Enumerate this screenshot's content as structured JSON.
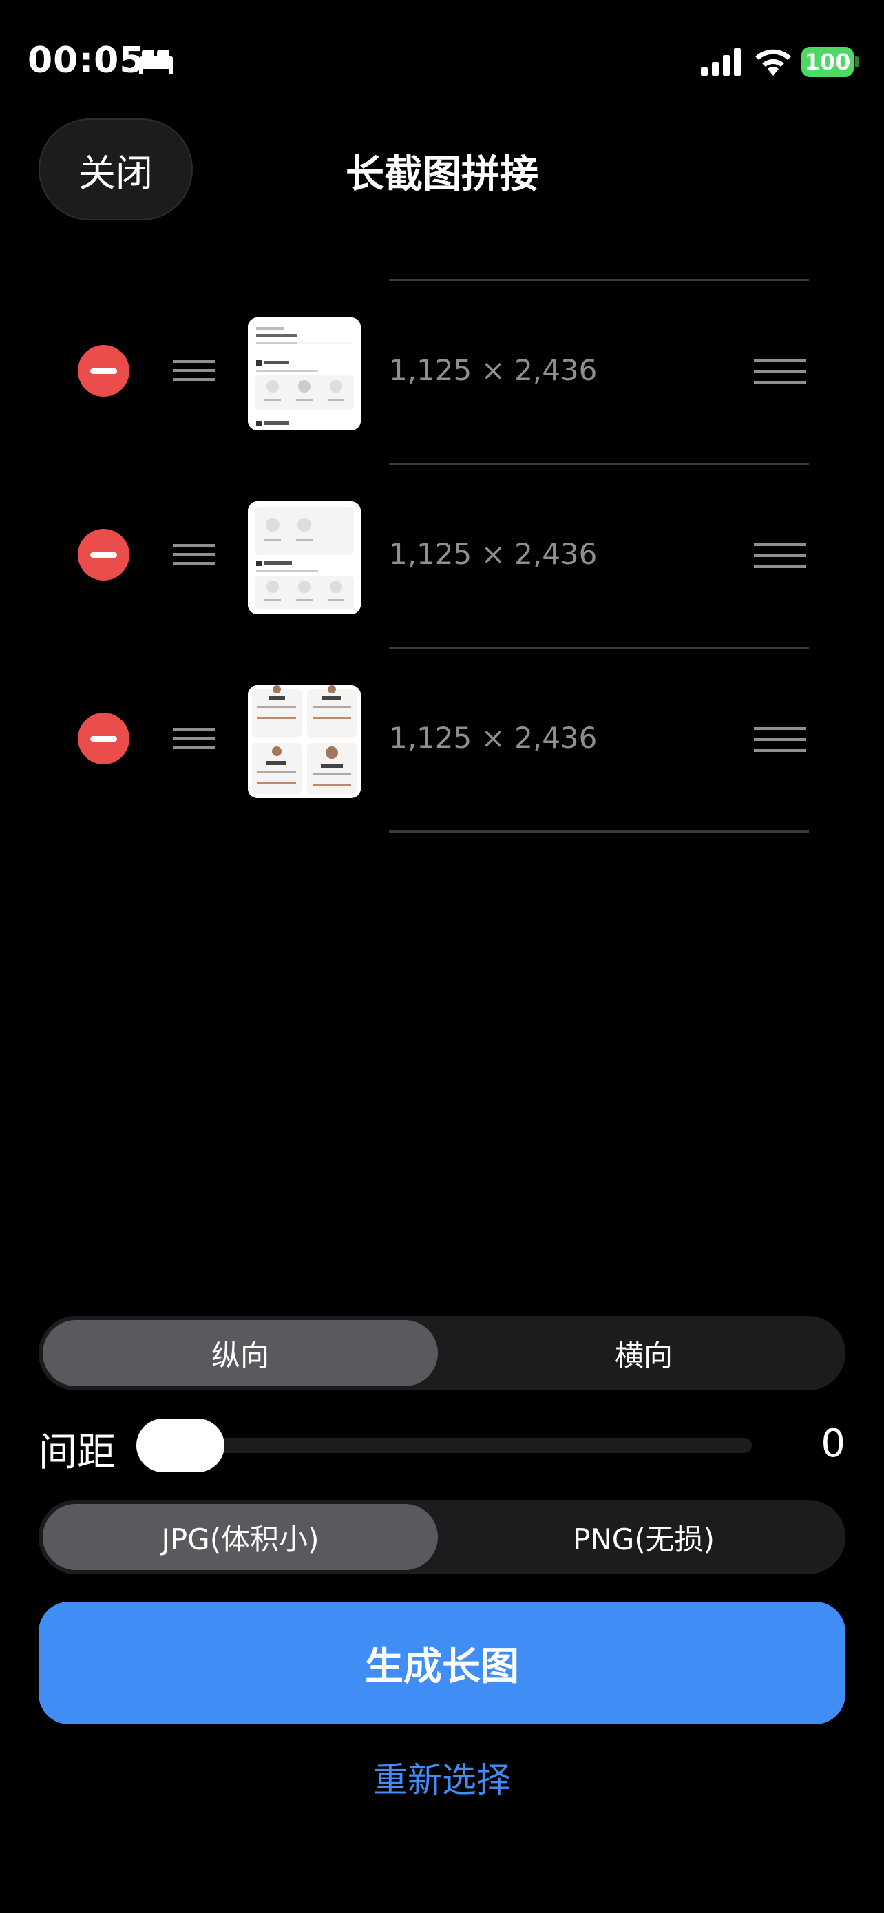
{
  "status": {
    "time": "00:05",
    "battery": "100"
  },
  "nav": {
    "close_label": "关闭",
    "title": "长截图拼接"
  },
  "images": [
    {
      "dims": "1,125 × 2,436"
    },
    {
      "dims": "1,125 × 2,436"
    },
    {
      "dims": "1,125 × 2,436"
    }
  ],
  "orientation": {
    "options": [
      "纵向",
      "横向"
    ],
    "selected": "纵向"
  },
  "spacing": {
    "label": "间距",
    "value": "0"
  },
  "format": {
    "options": [
      "JPG(体积小)",
      "PNG(无损)"
    ],
    "selected": "JPG(体积小)"
  },
  "actions": {
    "generate_label": "生成长图",
    "reselect_label": "重新选择"
  },
  "colors": {
    "accent": "#3f8df5",
    "delete": "#eb4d4b",
    "battery": "#4cd964"
  }
}
